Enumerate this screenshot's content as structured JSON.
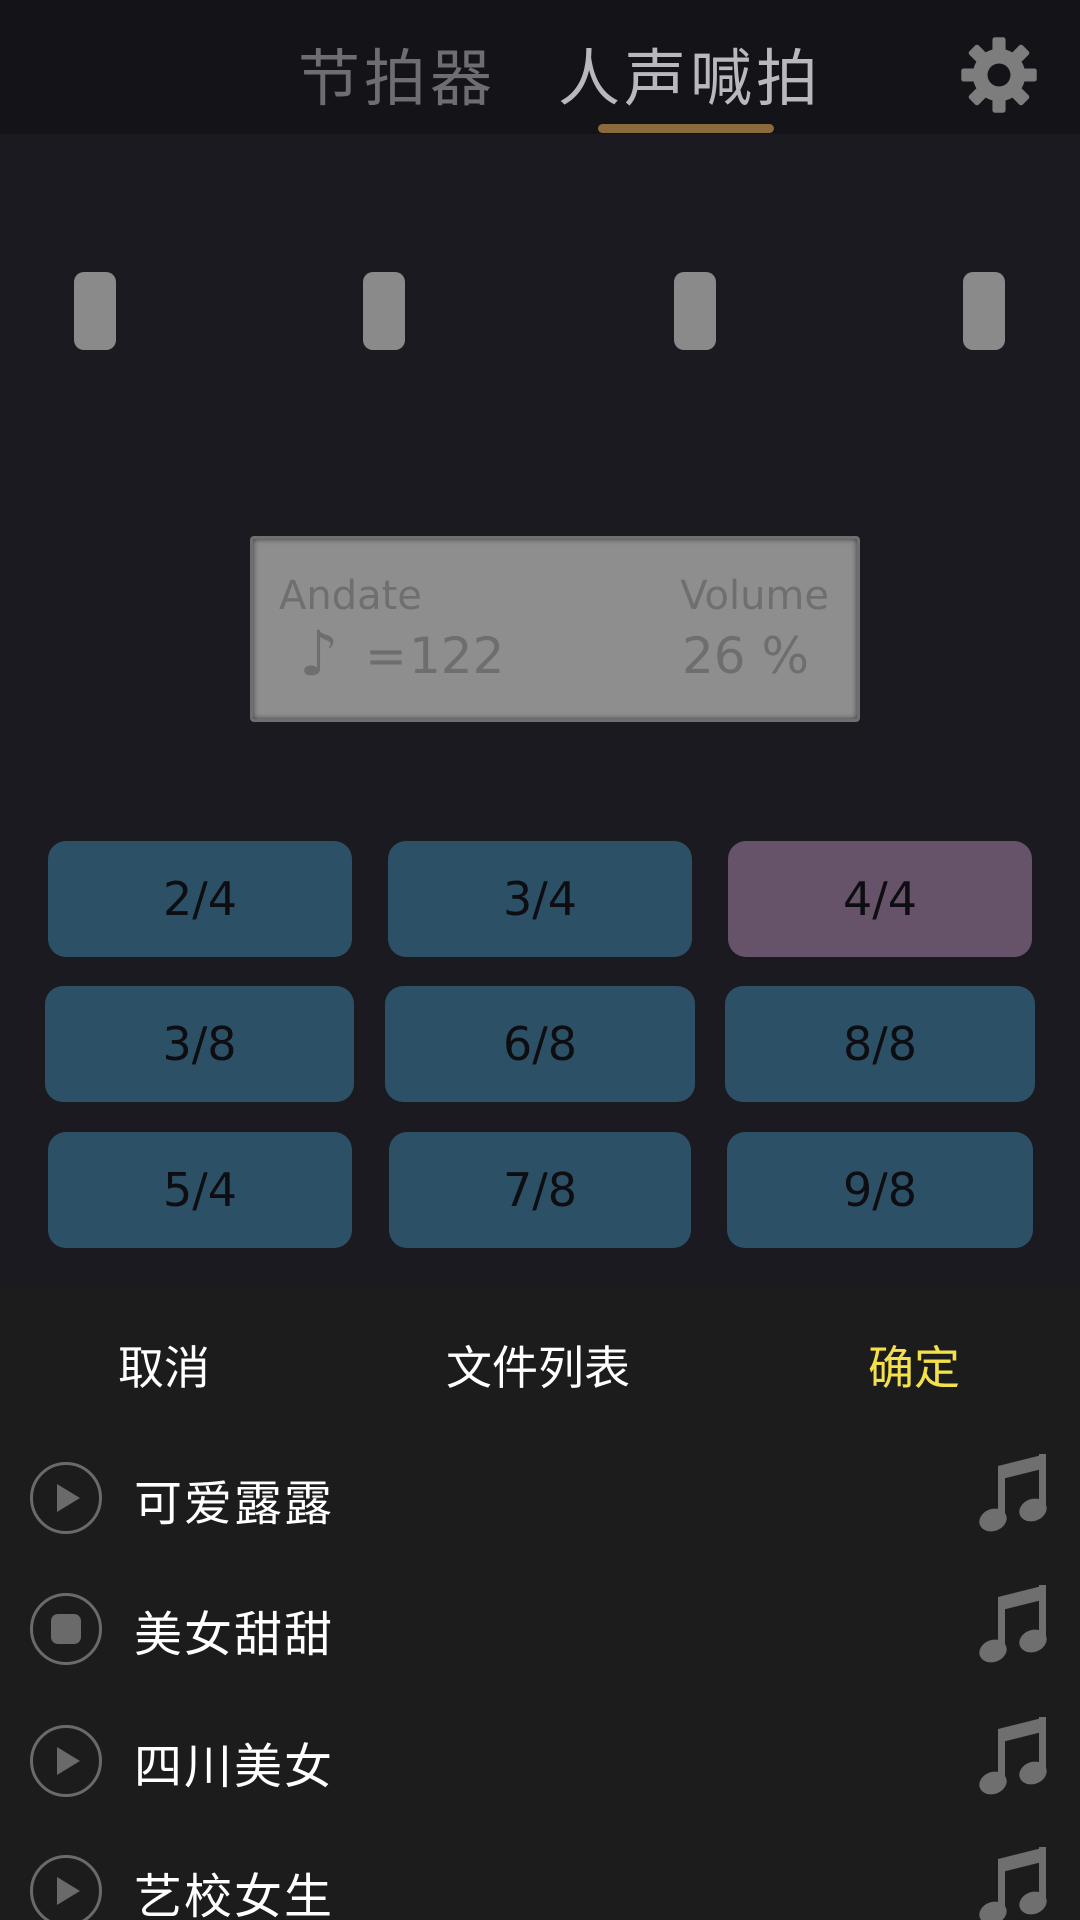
{
  "header": {
    "tabs": [
      {
        "label": "节拍器",
        "active": false
      },
      {
        "label": "人声喊拍",
        "active": true
      }
    ],
    "settings_icon": "gear-icon"
  },
  "beats": {
    "count": 4
  },
  "display": {
    "tempo_name": "Andate",
    "note_symbol": "♪",
    "equals": "=",
    "bpm": "122",
    "volume_label": "Volume",
    "volume_value": "26 %"
  },
  "time_signatures": {
    "options": [
      "2/4",
      "3/4",
      "4/4",
      "3/8",
      "6/8",
      "8/8",
      "5/4",
      "7/8",
      "9/8"
    ],
    "selected": "4/4"
  },
  "sheet": {
    "cancel_label": "取消",
    "title": "文件列表",
    "confirm_label": "确定",
    "items": [
      {
        "label": "可爱露露",
        "state": "play"
      },
      {
        "label": "美女甜甜",
        "state": "stop"
      },
      {
        "label": "四川美女",
        "state": "play"
      },
      {
        "label": "艺校女生",
        "state": "play"
      }
    ]
  },
  "colors": {
    "accent_underline": "#8b6a3b",
    "confirm": "#f4e04a",
    "button": "#2c5166",
    "button_selected": "#665369"
  }
}
